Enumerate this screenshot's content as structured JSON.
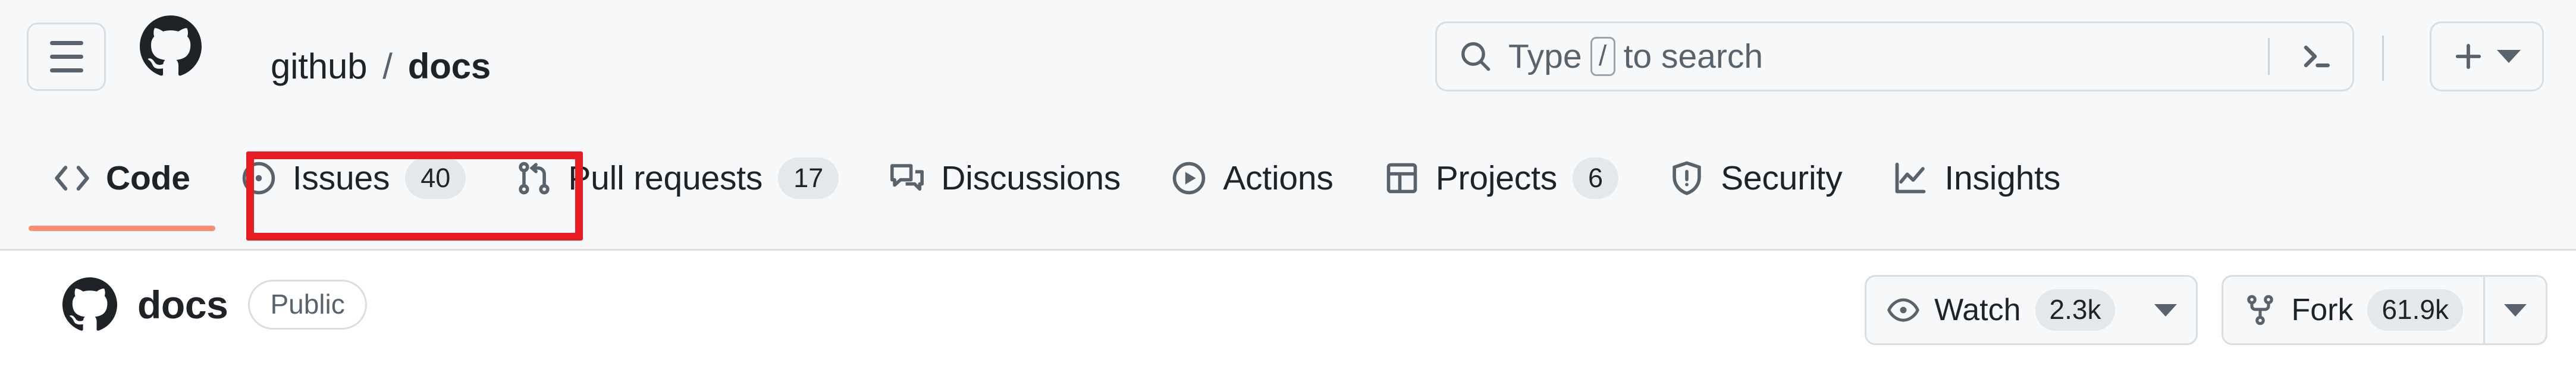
{
  "header": {
    "menu_button": "menu-icon",
    "logo": "github-logo",
    "breadcrumb": {
      "owner": "github",
      "separator": "/",
      "repo": "docs"
    },
    "search": {
      "icon": "search-icon",
      "placeholder_prefix": "Type",
      "placeholder_key": "/",
      "placeholder_suffix": "to search",
      "terminal_icon": "terminal-icon"
    },
    "add_new": {
      "icon": "plus-icon",
      "caret": "chevron-down-icon"
    }
  },
  "tabs": [
    {
      "label": "Code",
      "icon": "code-icon",
      "count": null,
      "active": true,
      "highlighted": false
    },
    {
      "label": "Issues",
      "icon": "issue-opened-icon",
      "count": "40",
      "active": false,
      "highlighted": true
    },
    {
      "label": "Pull requests",
      "icon": "git-pull-request-icon",
      "count": "17",
      "active": false,
      "highlighted": false
    },
    {
      "label": "Discussions",
      "icon": "comment-discussion-icon",
      "count": null,
      "active": false,
      "highlighted": false
    },
    {
      "label": "Actions",
      "icon": "play-icon",
      "count": null,
      "active": false,
      "highlighted": false
    },
    {
      "label": "Projects",
      "icon": "table-icon",
      "count": "6",
      "active": false,
      "highlighted": false
    },
    {
      "label": "Security",
      "icon": "shield-icon",
      "count": null,
      "active": false,
      "highlighted": false
    },
    {
      "label": "Insights",
      "icon": "graph-icon",
      "count": null,
      "active": false,
      "highlighted": false
    }
  ],
  "repo": {
    "icon": "repo-github-icon",
    "name": "docs",
    "visibility": "Public",
    "actions": [
      {
        "label": "Watch",
        "icon": "eye-icon",
        "count": "2.3k",
        "has_caret": true,
        "caret_divided": false
      },
      {
        "label": "Fork",
        "icon": "fork-icon",
        "count": "61.9k",
        "has_caret": true,
        "caret_divided": true
      }
    ]
  },
  "annotation": {
    "target": "Issues",
    "color": "#e81b23"
  },
  "colors": {
    "header_bg": "#f6f8fa",
    "body_bg": "#ffffff",
    "border": "#d9dee3",
    "text": "#1f2328",
    "muted": "#59636e",
    "active_underline": "#fd8c73",
    "counter_bg": "#e5e8eb",
    "annotation": "#e81b23"
  }
}
